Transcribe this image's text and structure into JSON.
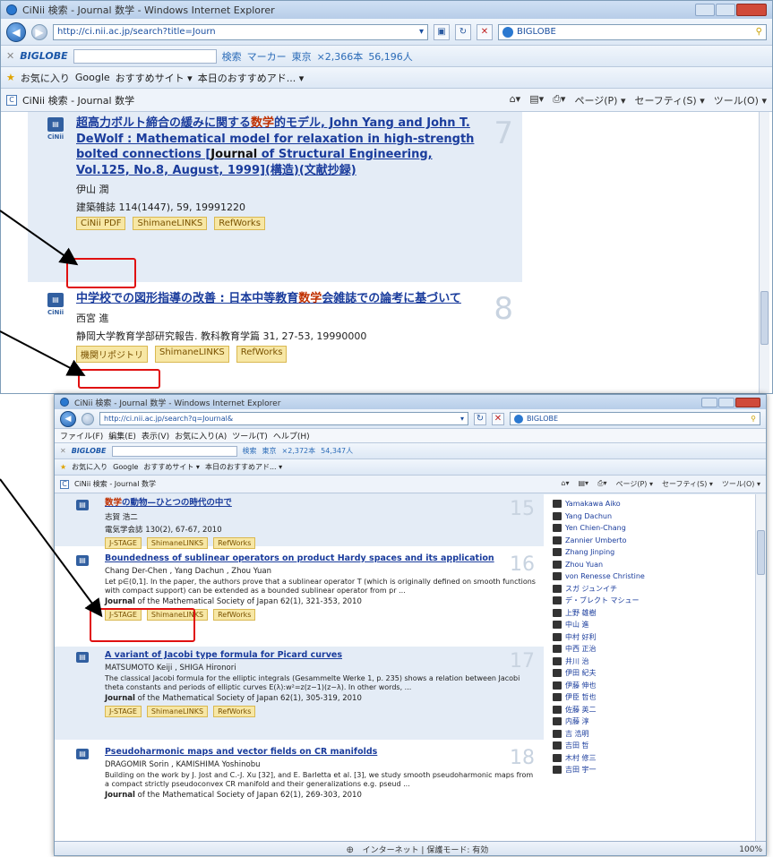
{
  "back_window": {
    "title": "CiNii 検索 - Journal 数学 - Windows Internet Explorer",
    "address": "http://ci.nii.ac.jp/search?title=Journ",
    "search_engine": "BIGLOBE",
    "toolbar2": {
      "logo": "BIGLOBE",
      "search": "検索",
      "marker": "マーカー",
      "weather": "東京",
      "count1": "×2,366本",
      "count2": "56,196人"
    },
    "favorites": {
      "label": "お気に入り",
      "google": "Google",
      "sites": "おすすめサイト ▾",
      "today": "本日のおすすめアド... ▾"
    },
    "tab": "CiNii 検索 - Journal 数学",
    "tools": [
      "ページ(P) ▾",
      "セーフティ(S) ▾",
      "ツール(O) ▾"
    ],
    "entries": [
      {
        "title_pre": "超高力ボルト締合の緩みに関する",
        "title_hl": "数学",
        "title_post": "的モデル, John Yang and John T. DeWolf : Mathematical model for relaxation in high-strength bolted connections [",
        "title_hl2": "Journal",
        "title_end": " of Structural Engineering, Vol.125, No.8, August, 1999](構造)(文献抄録)",
        "author": "伊山 潤",
        "source": "建築雑誌 114(1447), 59, 19991220",
        "tags": [
          "CiNii PDF",
          "ShimaneLINKS",
          "RefWorks"
        ],
        "num": "7"
      },
      {
        "title_pre": "中学校での図形指導の改善 : 日本中等教育",
        "title_hl": "数学",
        "title_post": "会雑誌での論考に基づいて",
        "author": "西宮 進",
        "source": "静岡大学教育学部研究報告. 教科教育学篇 31, 27-53, 19990000",
        "tags": [
          "機関リポジトリ",
          "ShimaneLINKS",
          "RefWorks"
        ],
        "num": "8"
      }
    ]
  },
  "front_window": {
    "title": "CiNii 検索 - Journal 数学 - Windows Internet Explorer",
    "address": "http://ci.nii.ac.jp/search?q=Journal&",
    "search_engine": "BIGLOBE",
    "menu": [
      "ファイル(F)",
      "編集(E)",
      "表示(V)",
      "お気に入り(A)",
      "ツール(T)",
      "ヘルプ(H)"
    ],
    "toolbar2": {
      "logo": "BIGLOBE",
      "search": "検索",
      "weather": "東京",
      "count1": "×2,372本",
      "count2": "54,347人"
    },
    "favorites": {
      "label": "お気に入り",
      "google": "Google",
      "sites": "おすすめサイト ▾",
      "today": "本日のおすすめアド... ▾"
    },
    "tab": "CiNii 検索 - Journal 数学",
    "tools": [
      "ページ(P) ▾",
      "セーフティ(S) ▾",
      "ツール(O) ▾"
    ],
    "entries": [
      {
        "title": "数学の動物—ひとつの時代の中で",
        "title_hl": "数学",
        "author": "志賀 浩二",
        "source": "電気学会誌 130(2), 67-67, 2010",
        "tags": [
          "J-STAGE",
          "ShimaneLINKS",
          "RefWorks"
        ],
        "num": "15"
      },
      {
        "title": "Boundedness of sublinear operators on product Hardy spaces and its application",
        "author": "Chang Der-Chen , Yang Dachun , Zhou Yuan",
        "abstract": "Let p∈(0,1]. In the paper, the authors prove that a sublinear operator T (which is originally defined on smooth functions with compact support) can be extended as a bounded sublinear operator from pr ...",
        "source_hl": "Journal",
        "source": " of the Mathematical Society of Japan 62(1), 321-353, 2010",
        "tags": [
          "J-STAGE",
          "ShimaneLINKS",
          "RefWorks"
        ],
        "num": "16"
      },
      {
        "title": "A variant of Jacobi type formula for Picard curves",
        "author": "MATSUMOTO Keiji , SHIGA Hironori",
        "abstract": "The classical Jacobi formula for the elliptic integrals (Gesammelte Werke 1, p. 235) shows a relation between Jacobi theta constants and periods of elliptic curves E(λ):w²=z(z−1)(z−λ). In other words, ...",
        "source_hl": "Journal",
        "source": " of the Mathematical Society of Japan 62(1), 305-319, 2010",
        "tags": [
          "J-STAGE",
          "ShimaneLINKS",
          "RefWorks"
        ],
        "num": "17"
      },
      {
        "title": "Pseudoharmonic maps and vector fields on CR manifolds",
        "author": "DRAGOMIR Sorin , KAMISHIMA Yoshinobu",
        "abstract": "Building on the work by J. Jost and C.-J. Xu [32], and E. Barletta et al. [3], we study smooth pseudoharmonic maps from a compact strictly pseudoconvex CR manifold and their generalizations e.g. pseud ...",
        "source_hl": "Journal",
        "source": " of the Mathematical Society of Japan 62(1), 269-303, 2010",
        "num": "18"
      }
    ],
    "sidebar_authors": [
      "Yamakawa Aiko",
      "Yang Dachun",
      "Yen Chien-Chang",
      "Zannier Umberto",
      "Zhang Jinping",
      "Zhou Yuan",
      "von Renesse Christine",
      "スガ ジュンイチ",
      "デ・ブレクト マシュー",
      "上野 雄樹",
      "中山 進",
      "中村 好利",
      "中西 正治",
      "井川 治",
      "伊田 紀夫",
      "伊藤 伸也",
      "伊臣 哲也",
      "佐藤 英二",
      "内藤 淳",
      "吉 浩明",
      "吉田 哲",
      "木村 修三",
      "吉田 宇一"
    ],
    "status": {
      "zone": "インターネット | 保護モード: 有効",
      "zoom": "100%"
    }
  }
}
